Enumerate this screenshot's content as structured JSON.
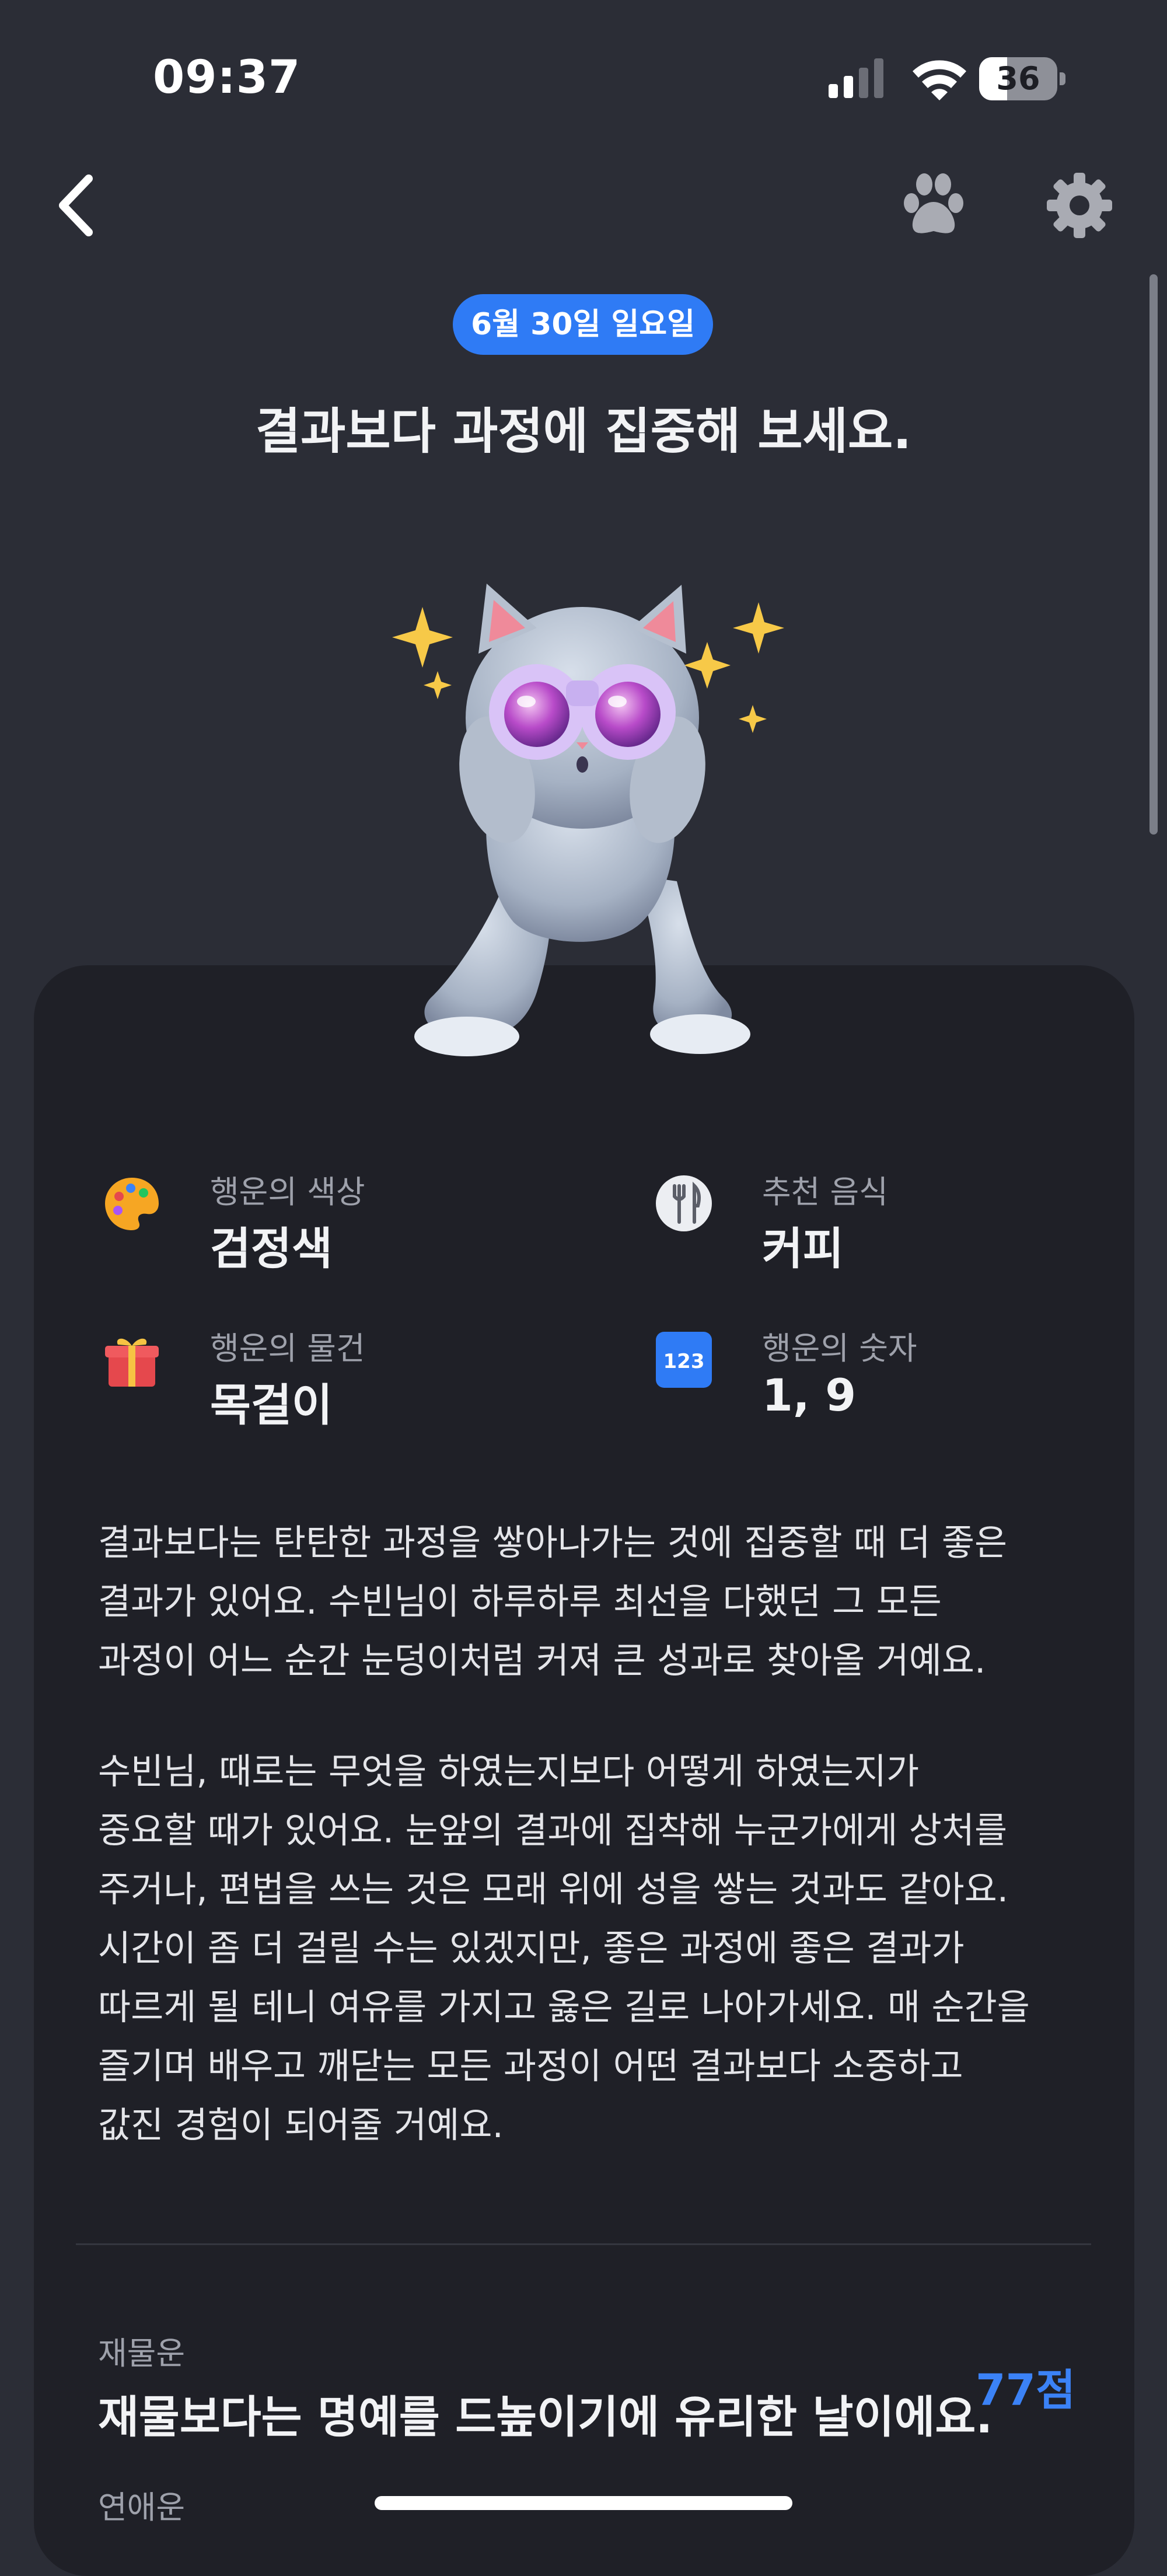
{
  "status_bar": {
    "time": "09:37",
    "battery_level": "36",
    "battery_fraction": 0.36
  },
  "nav": {
    "back_icon": "chevron-left-icon",
    "pet_icon": "paw-icon",
    "settings_icon": "gear-icon"
  },
  "header": {
    "date": "6월 30일 일요일",
    "headline": "결과보다 과정에 집중해 보세요."
  },
  "fortune_items": [
    {
      "icon": "palette-icon",
      "label": "행운의 색상",
      "value": "검정색"
    },
    {
      "icon": "fork-knife-icon",
      "label": "추천 음식",
      "value": "커피"
    },
    {
      "icon": "gift-icon",
      "label": "행운의 물건",
      "value": "목걸이"
    },
    {
      "icon": "number-123-icon",
      "label": "행운의 숫자",
      "value": "1, 9"
    }
  ],
  "paragraphs": {
    "p1": [
      "결과보다는 탄탄한 과정을 쌓아나가는 것에 집중할 때 더 좋은",
      "결과가 있어요. 수빈님이 하루하루 최선을 다했던 그 모든",
      "과정이 어느 순간 눈덩이처럼 커져 큰 성과로 찾아올 거예요."
    ],
    "p2": [
      "수빈님, 때로는 무엇을 하였는지보다 어떻게 하였는지가",
      "중요할 때가 있어요. 눈앞의 결과에 집착해 누군가에게 상처를",
      "주거나, 편법을 쓰는 것은 모래 위에 성을 쌓는 것과도 같아요.",
      "시간이 좀 더 걸릴 수는 있겠지만, 좋은 과정에 좋은 결과가",
      "따르게 될 테니 여유를 가지고 옳은 길로 나아가세요. 매 순간을",
      "즐기며 배우고 깨닫는 모든 과정이 어떤 결과보다 소중하고",
      "값진 경험이 되어줄 거예요."
    ]
  },
  "wealth": {
    "label": "재물운",
    "text": "재물보다는 명예를 드높이기에 유리한 날이에요.",
    "score": "77점"
  },
  "love": {
    "label": "연애운"
  },
  "colors": {
    "background": "#2b2d36",
    "card": "#1f2027",
    "accent": "#2f7bf5",
    "score": "#3b82f6"
  }
}
